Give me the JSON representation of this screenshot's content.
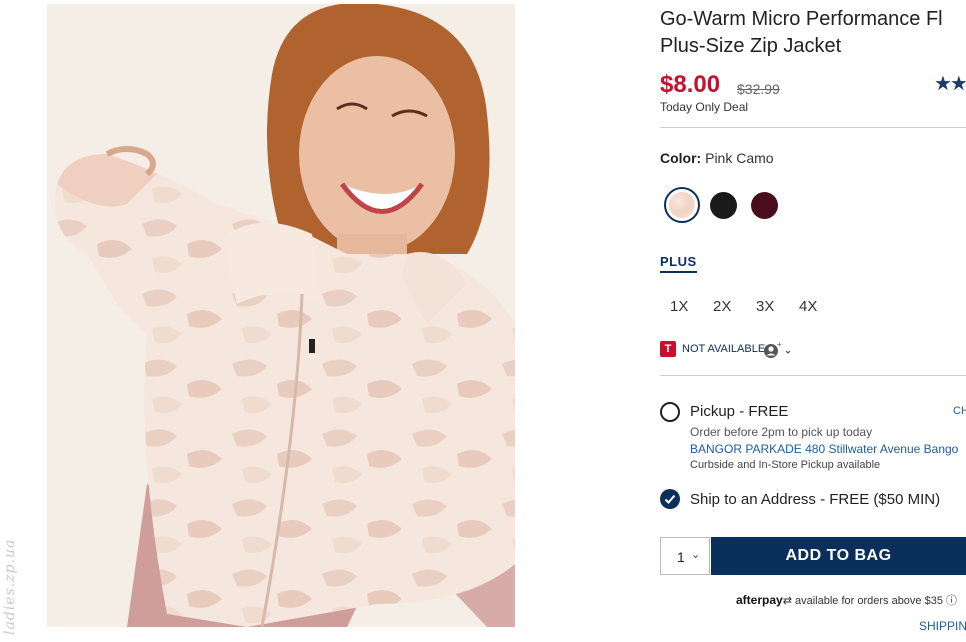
{
  "product": {
    "title_line1": "Go-Warm Micro Performance Fl",
    "title_line2": "Plus-Size Zip Jacket",
    "price": "$8.00",
    "original_price": "$32.99",
    "deal_label": "Today Only Deal",
    "rating_stars": "★★"
  },
  "color": {
    "label": "Color:",
    "value": "Pink Camo",
    "swatches": [
      {
        "name": "Pink Camo",
        "hex": "#f3d9cc",
        "selected": true
      },
      {
        "name": "Black",
        "hex": "#1a1a1a",
        "selected": false
      },
      {
        "name": "Wine",
        "hex": "#4a0d1e",
        "selected": false
      }
    ]
  },
  "size": {
    "tab_label": "PLUS",
    "options": [
      "1X",
      "2X",
      "3X",
      "4X"
    ]
  },
  "availability": {
    "badge_glyph": "T",
    "text": "NOT AVAILABLE",
    "icon": "person-icon"
  },
  "fulfillment": {
    "pickup_label": "Pickup - FREE",
    "pickup_note": "Order before 2pm to pick up today",
    "store_text": "BANGOR PARKADE 480 Stillwater Avenue  Bango",
    "curbside_text": "Curbside and In-Store Pickup available",
    "change_link": "CH",
    "ship_label": "Ship to an Address - FREE ($50 MIN)"
  },
  "cart": {
    "quantity": "1",
    "add_to_bag_label": "ADD TO BAG"
  },
  "afterpay": {
    "brand": "afterpay",
    "text": "available for orders above $35",
    "info_icon": "info-icon"
  },
  "shipping_link": "SHIPPING",
  "watermark": "ladies.zp.ua",
  "colors": {
    "brand_navy": "#0b2f5b",
    "price_red": "#c8102e",
    "link_blue": "#1f5c9e"
  }
}
